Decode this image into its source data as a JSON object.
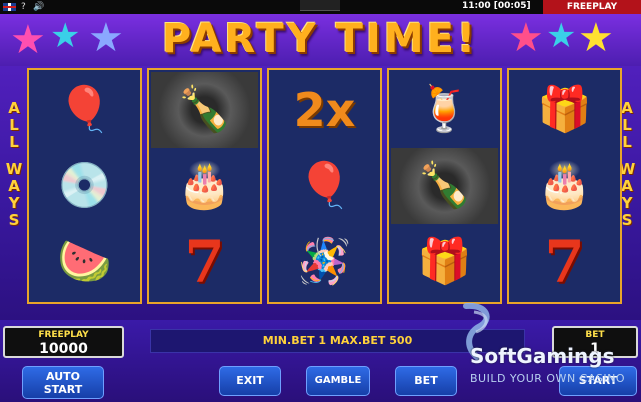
{
  "topbar": {
    "flag_icon": "uk-flag-icon",
    "help": "?",
    "sound": "🔊",
    "time": "11:00 [00:05]",
    "mode": "FREEPLAY"
  },
  "title": "PARTY TIME!",
  "side_left": [
    "A",
    "L",
    "L",
    "",
    "W",
    "A",
    "Y",
    "S"
  ],
  "side_right": [
    "A",
    "L",
    "L",
    "",
    "W",
    "A",
    "Y",
    "S"
  ],
  "reels": [
    [
      "balloons-7",
      "vinyl-record",
      "watermelon-drink"
    ],
    [
      "champagne",
      "birthday-cake",
      "seven"
    ],
    [
      "2x",
      "balloons-7",
      "pinata"
    ],
    [
      "cocktail",
      "champagne",
      "gift-box"
    ],
    [
      "gift-box",
      "birthday-cake",
      "seven"
    ]
  ],
  "symbols": {
    "seven": "7",
    "two_x": "2x",
    "balloons": "🎈",
    "vinyl": "💿",
    "watermelon": "🍉",
    "champagne": "🍾",
    "cake": "🎂",
    "pinata": "🪅",
    "cocktail": "🍹",
    "gift": "🎁"
  },
  "freeplay_panel": {
    "label": "FREEPLAY",
    "value": "10000"
  },
  "bet_panel": {
    "label": "BET",
    "value": "1"
  },
  "info": "MIN.BET 1 MAX.BET 500",
  "buttons": {
    "auto_start": [
      "AUTO",
      "START"
    ],
    "exit": "EXIT",
    "gamble": "GAMBLE",
    "bet": "BET",
    "start": "START"
  },
  "logo": {
    "name": "SoftGamings",
    "tag": "BUILD YOUR OWN CASINO"
  },
  "colors": {
    "title": "#ffb01e",
    "reel_border": "#e8a52a",
    "button": "#2f6be6",
    "mode_tag": "#b3121a"
  }
}
